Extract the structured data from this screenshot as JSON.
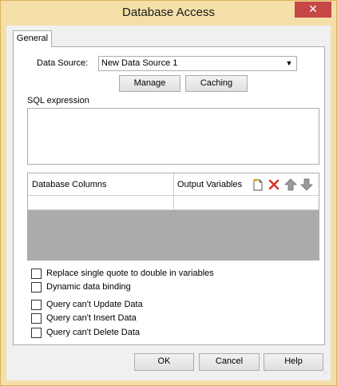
{
  "window": {
    "title": "Database Access",
    "close_glyph": "✕"
  },
  "tabs": [
    {
      "label": "General"
    }
  ],
  "datasource": {
    "label": "Data Source:",
    "value": "New Data Source 1",
    "manage_label": "Manage",
    "caching_label": "Caching"
  },
  "sql": {
    "label": "SQL expression",
    "value": ""
  },
  "grid": {
    "columns": [
      "Database Columns",
      "Output Variables"
    ],
    "toolbar_icons": [
      "new-row-icon",
      "delete-row-icon",
      "move-up-icon",
      "move-down-icon"
    ],
    "rows": []
  },
  "options": [
    {
      "label": "Replace single quote to double in variables",
      "checked": false
    },
    {
      "label": "Dynamic data binding",
      "checked": false
    },
    {
      "label": "Query can't Update Data",
      "checked": false
    },
    {
      "label": "Query can't Insert Data",
      "checked": false
    },
    {
      "label": "Query can't Delete Data",
      "checked": false
    }
  ],
  "buttons": {
    "ok": "OK",
    "cancel": "Cancel",
    "help": "Help"
  },
  "colors": {
    "titlebar": "#f4dfa8",
    "close": "#c74646",
    "delete_icon": "#d9342b",
    "arrow_icon": "#8c8c8c"
  }
}
